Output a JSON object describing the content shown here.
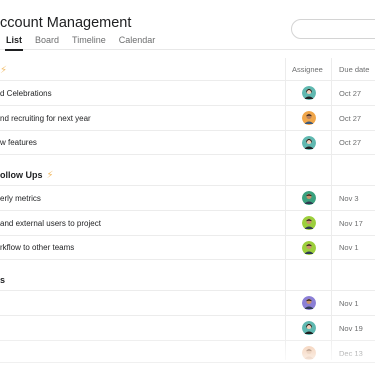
{
  "header": {
    "title": "ccount Management",
    "tabs": [
      {
        "label": "List",
        "active": true
      },
      {
        "label": "Board",
        "active": false
      },
      {
        "label": "Timeline",
        "active": false
      },
      {
        "label": "Calendar",
        "active": false
      }
    ]
  },
  "columns": {
    "assignee": "Assignee",
    "due_date": "Due date"
  },
  "sections": [
    {
      "title": "",
      "bolt": "⚡",
      "tasks": [
        {
          "name": "d Celebrations",
          "due": "Oct 27",
          "avatar_bg": "#5fb8b0"
        },
        {
          "name": "nd recruiting for next year",
          "due": "Oct 27",
          "avatar_bg": "#f0a64a"
        },
        {
          "name": "w features",
          "due": "Oct 27",
          "avatar_bg": "#5fb8b0"
        }
      ]
    },
    {
      "title": "ollow Ups",
      "bolt": "⚡",
      "tasks": [
        {
          "name": "erly metrics",
          "due": "Nov 3",
          "avatar_bg": "#3aa17e"
        },
        {
          "name": "and external users to project",
          "due": "Nov 17",
          "avatar_bg": "#9ccf3c"
        },
        {
          "name": "rkflow to other teams",
          "due": "Nov 1",
          "avatar_bg": "#9ccf3c"
        }
      ]
    },
    {
      "title": "s",
      "bolt": "",
      "tasks": [
        {
          "name": "",
          "due": "Nov 1",
          "avatar_bg": "#8b7fd6"
        },
        {
          "name": "",
          "due": "Nov 19",
          "avatar_bg": "#5fb8b0"
        },
        {
          "name": "",
          "due": "Dec 13",
          "avatar_bg": "#f2c7a8"
        }
      ]
    }
  ],
  "colors": {
    "bolt": "#f1bd6c",
    "accent_text": "#1e1f21",
    "muted_text": "#6d6e6f"
  }
}
